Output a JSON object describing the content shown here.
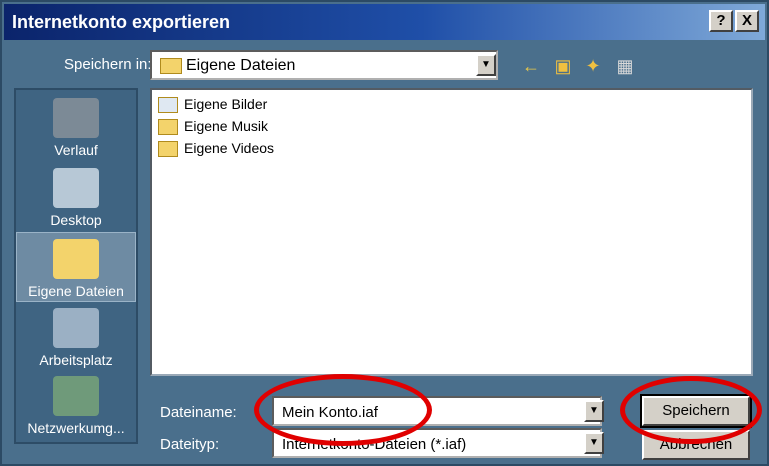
{
  "window": {
    "title": "Internetkonto exportieren",
    "help_label": "?",
    "close_label": "X"
  },
  "save_in": {
    "label": "Speichern in:",
    "value": "Eigene Dateien"
  },
  "toolbar": {
    "icons": [
      "back-icon",
      "up-folder-icon",
      "new-folder-icon",
      "view-menu-icon"
    ]
  },
  "places": [
    {
      "label": "Verlauf",
      "icon": "history-icon"
    },
    {
      "label": "Desktop",
      "icon": "desktop-icon"
    },
    {
      "label": "Eigene Dateien",
      "icon": "my-documents-icon"
    },
    {
      "label": "Arbeitsplatz",
      "icon": "my-computer-icon"
    },
    {
      "label": "Netzwerkumg...",
      "icon": "network-icon"
    }
  ],
  "files": [
    {
      "name": "Eigene Bilder",
      "icon": "pictures-folder-icon"
    },
    {
      "name": "Eigene Musik",
      "icon": "folder-icon"
    },
    {
      "name": "Eigene Videos",
      "icon": "folder-icon"
    }
  ],
  "filename": {
    "label": "Dateiname:",
    "value": "Mein Konto.iaf"
  },
  "filetype": {
    "label": "Dateityp:",
    "value": "Internetkonto-Dateien (*.iaf)"
  },
  "buttons": {
    "save": "Speichern",
    "cancel": "Abbrechen"
  },
  "annotation_color": "#e00000"
}
